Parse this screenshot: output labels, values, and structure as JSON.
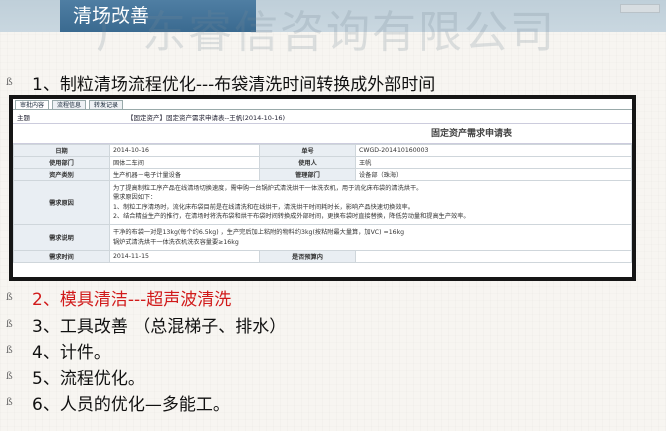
{
  "header": {
    "title": "清场改善"
  },
  "watermark": "广东睿信咨询有限公司",
  "items": [
    {
      "bullet": "ß",
      "text": "1、制粒清场流程优化---布袋清洗时间转换成外部时间"
    },
    {
      "bullet": "ß",
      "text": "2、模具清洁---超声波清洗"
    },
    {
      "bullet": "ß",
      "text": "3、工具改善 （总混梯子、排水）"
    },
    {
      "bullet": "ß",
      "text": "4、计件。"
    },
    {
      "bullet": "ß",
      "text": "5、流程优化。"
    },
    {
      "bullet": "ß",
      "text": "6、人员的优化—多能工。"
    }
  ],
  "screenshot": {
    "tabs": [
      "审批内容",
      "流程信息",
      "转发记录"
    ],
    "subject_label": "主题",
    "subject_value": "【固定资产】固定资产需求申请表--王帆(2014-10-16)",
    "form_title": "固定资产需求申请表",
    "rows": {
      "date_label": "日期",
      "date_value": "2014-10-16",
      "no_label": "单号",
      "no_value": "CWGD-201410160003",
      "dept_label": "使用部门",
      "dept_value": "固体二车间",
      "user_label": "使用人",
      "user_value": "王帆",
      "category_label": "资产类别",
      "category_value": "生产机器－电子计量设备",
      "manager_label": "管理部门",
      "manager_value": "设备部（珠海）",
      "reason_label": "需求原因",
      "reason_lines": [
        "为了提高制粒工序产品在线清场切换速度，需申购一台锅炉式清洗烘干一体洗衣机，用于流化床布袋的清洗烘干。",
        "需求原因如下：",
        "1、制粒工序清场时，流化床布袋目前是在线清洗和在线烘干，清洗烘干时间耗时长，影响产品快速切换效率。",
        "2、结合精益生产的推行，在清场时将洗布袋和烘干布袋时间转换成外部时间，更换布袋时直接替换，降低劳动量和提高生产效率。"
      ],
      "desc_label": "需求说明",
      "desc_lines": [
        "干净的布袋一对是13kg(每个约6.5kg) ，生产完后加上粘附的物料约3kg(按粘附最大量算，加VC)  =16kg",
        "锅炉式清洗烘干一体洗衣机洗衣容量要≥16kg"
      ],
      "time_label": "需求时间",
      "time_value": "2014-11-15",
      "budget_label": "是否预算内",
      "budget_value": ""
    }
  }
}
